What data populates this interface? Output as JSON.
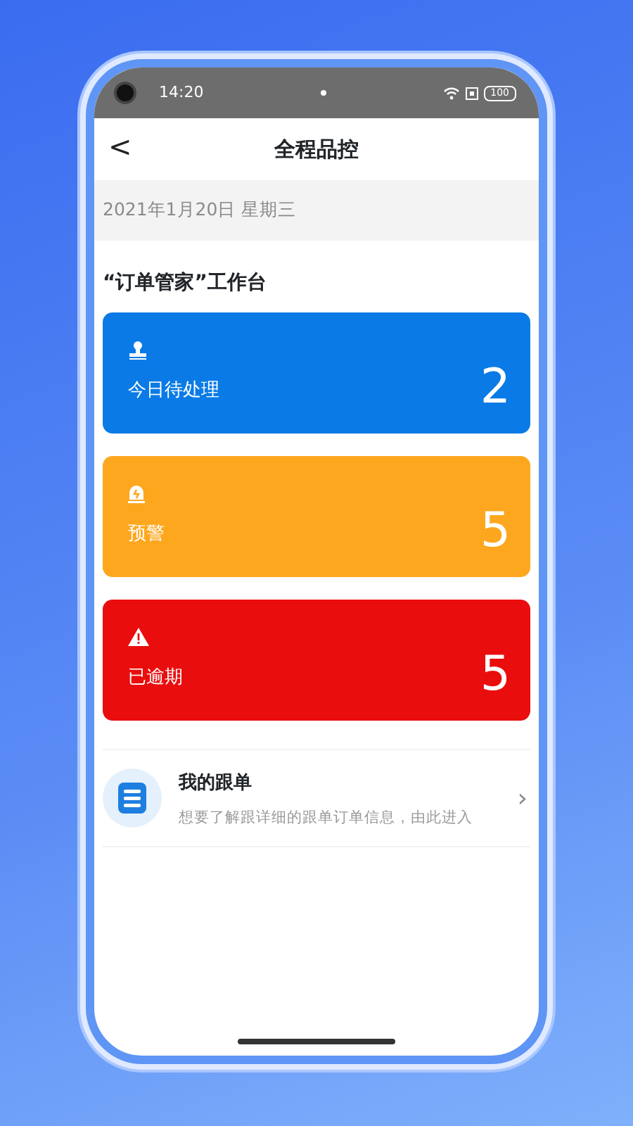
{
  "status_bar": {
    "time": "14:20",
    "battery": "100"
  },
  "header": {
    "back": "<",
    "title": "全程品控"
  },
  "date": "2021年1月20日 星期三",
  "section_title": "“订单管家”工作台",
  "cards": [
    {
      "kind": "stamp",
      "label": "今日待处理",
      "count": "2",
      "color": "#0a7be6"
    },
    {
      "kind": "alarm",
      "label": "预警",
      "count": "5",
      "color": "#fda71f"
    },
    {
      "kind": "warning",
      "label": "已逾期",
      "count": "5",
      "color": "#ea0d0d"
    }
  ],
  "entry": {
    "title": "我的跟单",
    "subtitle": "想要了解跟详细的跟单订单信息，由此进入",
    "chevron": "›"
  }
}
